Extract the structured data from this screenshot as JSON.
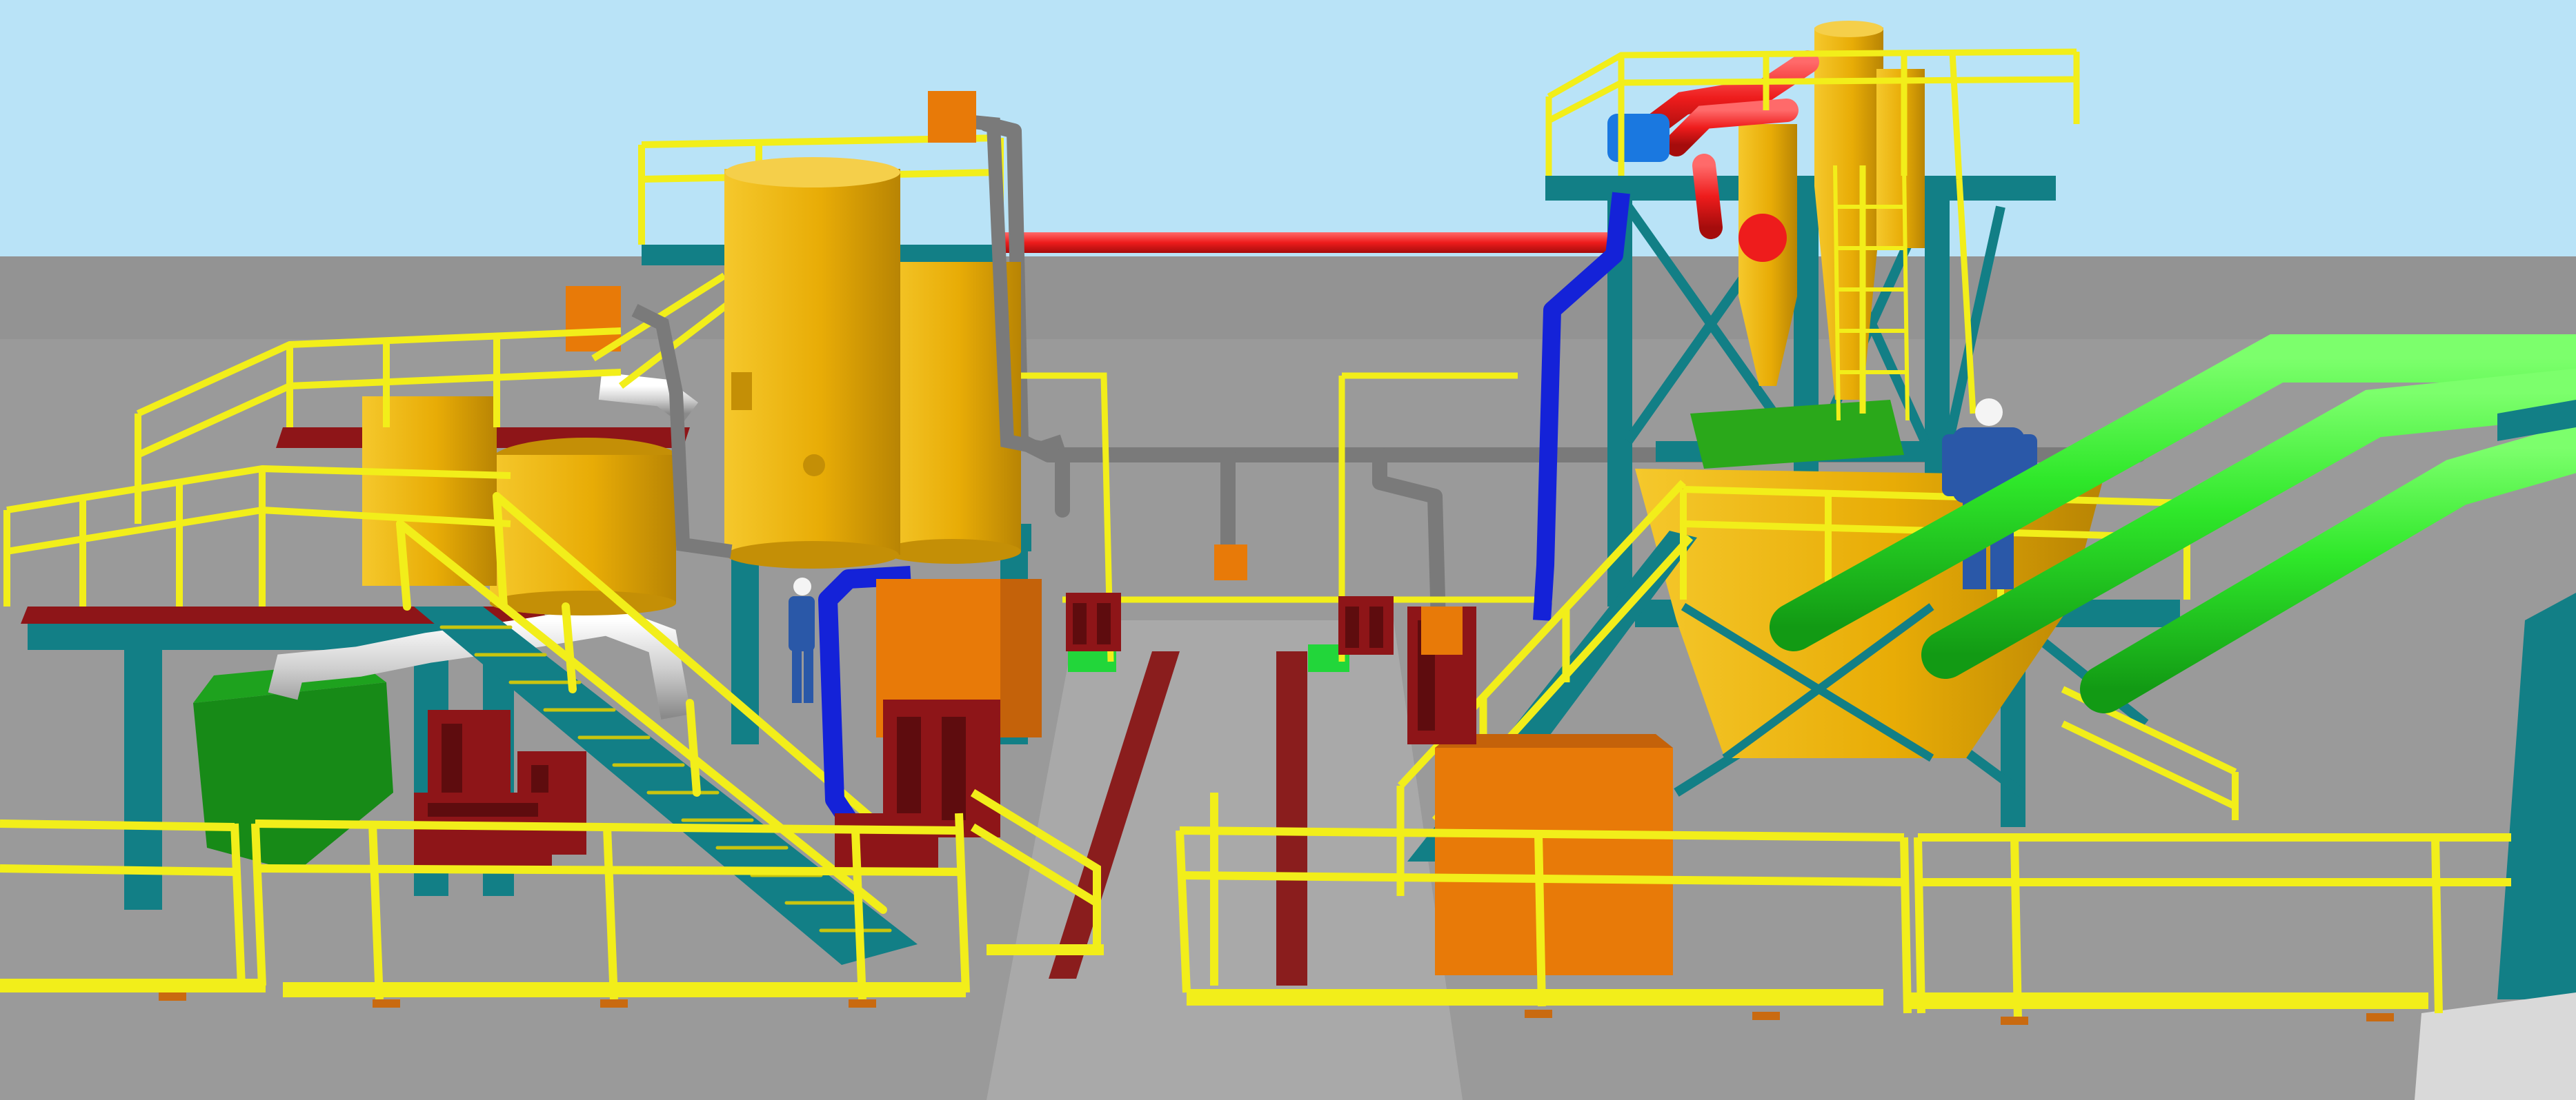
{
  "scene": {
    "kind": "3d-plant-model-render",
    "palette": {
      "sky": "#b9e3f7",
      "floor": "#9a9a9a",
      "floor_far": "#8c8c8c",
      "structure_teal": "#127f86",
      "structure_teal_dark": "#0c5f66",
      "handrail_yellow": "#f2ee1a",
      "handrail_yellow_dark": "#c9c50e",
      "tank_gold": "#eab40a",
      "tank_gold_dark": "#c48f06",
      "box_orange": "#e87a08",
      "box_orange_dark": "#c4620a",
      "pump_maroon": "#8e1518",
      "pump_maroon_dark": "#5e0c0e",
      "pipe_red": "#ee1c1c",
      "pipe_blue": "#1422d8",
      "pipe_green": "#2fe82a",
      "pipe_green_dark": "#18a81a",
      "pipe_grey": "#7a7a7a",
      "pipe_silver": "#d7d7d7",
      "hopper_green": "#178a17",
      "floor_plate_green": "#22d63a",
      "floor_drain": "#8a1d1d",
      "worker_blue": "#2a58a8",
      "helmet_white": "#f4f4f4",
      "base_plate_orange": "#c96a10"
    },
    "equipment": [
      {
        "name": "tall-process-tank",
        "color": "tank_gold"
      },
      {
        "name": "mid-process-tank",
        "color": "tank_gold"
      },
      {
        "name": "cyclone-tower",
        "color": "tank_gold"
      },
      {
        "name": "conical-hopper",
        "color": "tank_gold"
      },
      {
        "name": "orange-control-cabinet",
        "color": "box_orange"
      },
      {
        "name": "green-collection-hopper",
        "color": "hopper_green"
      },
      {
        "name": "pump-units",
        "color": "pump_maroon"
      },
      {
        "name": "red-overhead-pipe",
        "color": "pipe_red"
      },
      {
        "name": "blue-duct",
        "color": "pipe_blue"
      },
      {
        "name": "green-pipe-bundle",
        "color": "pipe_green"
      },
      {
        "name": "stairs-and-platforms",
        "color": "handrail_yellow"
      },
      {
        "name": "workers",
        "color": "worker_blue"
      }
    ]
  }
}
